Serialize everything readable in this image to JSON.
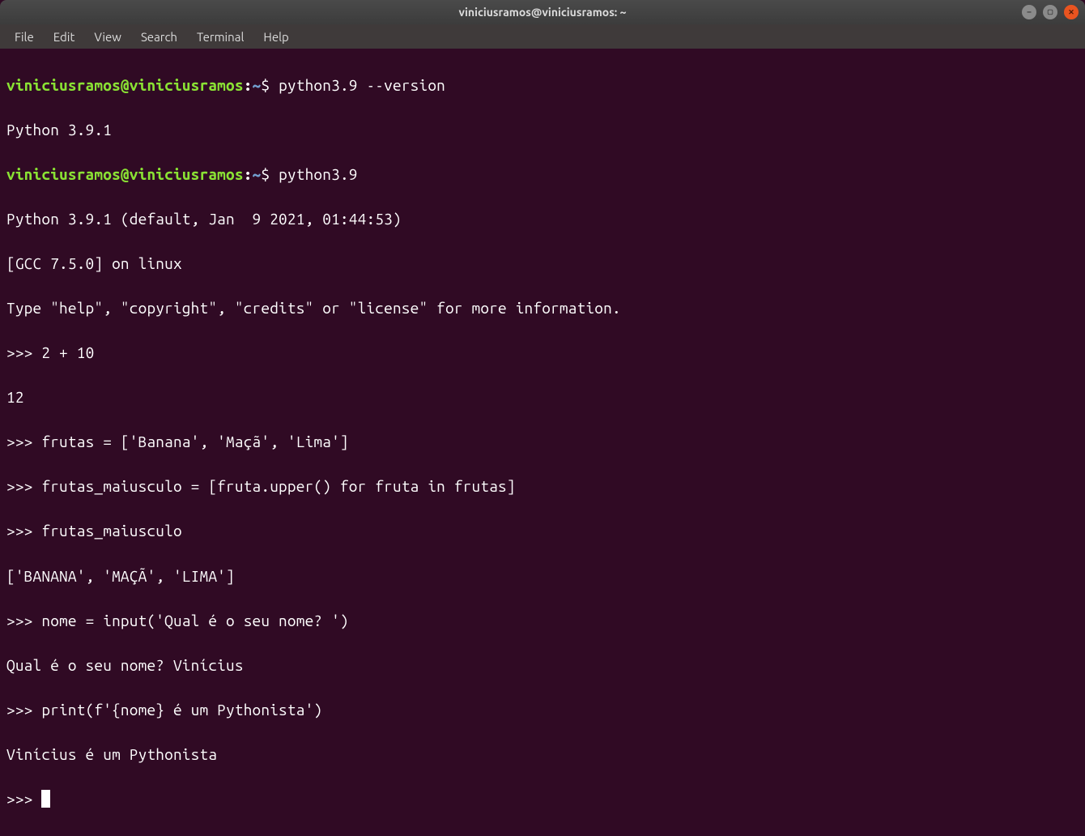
{
  "window": {
    "title": "viniciusramos@viniciusramos: ~"
  },
  "menu": {
    "file": "File",
    "edit": "Edit",
    "view": "View",
    "search": "Search",
    "terminal": "Terminal",
    "help": "Help"
  },
  "ps1": {
    "user": "viniciusramos",
    "at": "@",
    "host": "viniciusramos",
    "colon": ":",
    "path": "~",
    "dollar": "$"
  },
  "term": {
    "cmd1": "python3.9 --version",
    "out1": "Python 3.9.1",
    "cmd2": "python3.9",
    "out2a": "Python 3.9.1 (default, Jan  9 2021, 01:44:53) ",
    "out2b": "[GCC 7.5.0] on linux",
    "out2c": "Type \"help\", \"copyright\", \"credits\" or \"license\" for more information.",
    "p1": ">>> ",
    "py1": "2 + 10",
    "pyo1": "12",
    "py2": "frutas = ['Banana', 'Maçã', 'Lima']",
    "py3": "frutas_maiusculo = [fruta.upper() for fruta in frutas]",
    "py4": "frutas_maiusculo",
    "pyo4": "['BANANA', 'MAÇÃ', 'LIMA']",
    "py5": "nome = input('Qual é o seu nome? ')",
    "pyo5": "Qual é o seu nome? Vinícius",
    "py6": "print(f'{nome} é um Pythonista')",
    "pyo6": "Vinícius é um Pythonista"
  }
}
